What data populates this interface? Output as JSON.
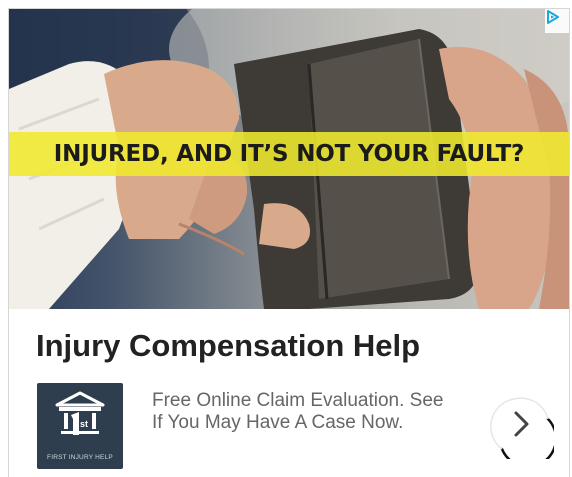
{
  "ad": {
    "hero": {
      "headline": "INJURED, AND IT’S NOT YOUR FAULT?",
      "highlight_color": "#f0e92d"
    },
    "title": "Injury Compensation Help",
    "logo": {
      "caption": "FIRST INJURY HELP",
      "background_color": "#2e3e4f"
    },
    "description": "Free Online Claim Evaluation. See If You May Have A Case Now.",
    "icons": {
      "adchoices": "adchoices-icon",
      "cta": "chevron-right-icon"
    },
    "accent_color": "#1aa7e0"
  }
}
